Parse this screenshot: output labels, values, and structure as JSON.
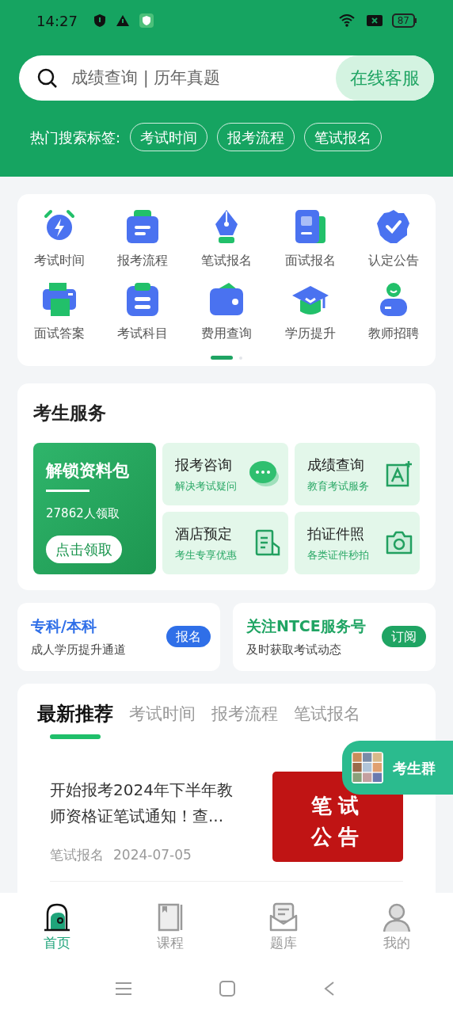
{
  "status_bar": {
    "time": "14:27",
    "battery": "87"
  },
  "search": {
    "placeholder": "成绩查询 | 历年真题",
    "service_button": "在线客服"
  },
  "hot_tags": {
    "label": "热门搜索标签:",
    "tags": [
      "考试时间",
      "报考流程",
      "笔试报名"
    ]
  },
  "shortcuts": [
    {
      "label": "考试时间"
    },
    {
      "label": "报考流程"
    },
    {
      "label": "笔试报名"
    },
    {
      "label": "面试报名"
    },
    {
      "label": "认定公告"
    },
    {
      "label": "面试答案"
    },
    {
      "label": "考试科目"
    },
    {
      "label": "费用查询"
    },
    {
      "label": "学历提升"
    },
    {
      "label": "教师招聘"
    }
  ],
  "pager": [
    {
      "selected": true
    },
    {
      "selected": false
    }
  ],
  "services": {
    "title": "考生服务",
    "promo": {
      "title": "解锁资料包",
      "count": "27862人领取",
      "button": "点击领取"
    },
    "items": [
      {
        "title": "报考咨询",
        "subtitle": "解决考试疑问",
        "kind": "chat"
      },
      {
        "title": "成绩查询",
        "subtitle": "教育考试服务",
        "kind": "score"
      },
      {
        "title": "酒店预定",
        "subtitle": "考生专享优惠",
        "kind": "hotel"
      },
      {
        "title": "拍证件照",
        "subtitle": "各类证件秒拍",
        "kind": "camera"
      }
    ]
  },
  "banners": [
    {
      "title": "专科/本科",
      "subtitle": "成人学历提升通道",
      "button": "报名",
      "color": "#2f6fe8"
    },
    {
      "title": "关注NTCE服务号",
      "subtitle": "及时获取考试动态",
      "button": "订阅",
      "color": "#1fa463"
    }
  ],
  "feed": {
    "tabs": [
      {
        "label": "最新推荐",
        "selected": true
      },
      {
        "label": "考试时间",
        "selected": false
      },
      {
        "label": "报考流程",
        "selected": false
      },
      {
        "label": "笔试报名",
        "selected": false
      }
    ],
    "articles": [
      {
        "title": "开始报考2024年下半年教师资格证笔试通知！查...",
        "category": "笔试报名",
        "date": "2024-07-05",
        "thumb_lines": [
          "笔试",
          "公告"
        ]
      }
    ]
  },
  "floating_button": {
    "label": "考生群"
  },
  "bottom_nav": [
    {
      "label": "首页",
      "selected": true
    },
    {
      "label": "课程",
      "selected": false
    },
    {
      "label": "题库",
      "selected": false
    },
    {
      "label": "我的",
      "selected": false
    }
  ]
}
